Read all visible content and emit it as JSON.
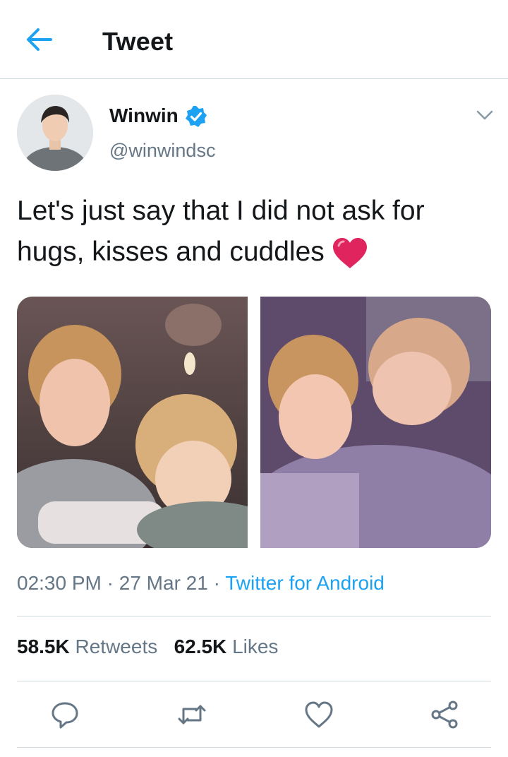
{
  "header": {
    "title": "Tweet",
    "back_icon": "arrow-left-icon"
  },
  "author": {
    "name": "Winwin",
    "handle": "@winwindsc",
    "verified": true,
    "verified_icon": "verified-badge-icon"
  },
  "tweet": {
    "text": "Let's just say that I did not ask for hugs, kisses and cuddles",
    "emoji": "red-heart-emoji"
  },
  "media": [
    {
      "name": "photo-1"
    },
    {
      "name": "photo-2"
    }
  ],
  "meta": {
    "time": "02:30 PM",
    "sep1": " · ",
    "date": "27 Mar 21",
    "sep2": " · ",
    "source": "Twitter for Android"
  },
  "stats": {
    "retweets_count": "58.5K",
    "retweets_label": "Retweets",
    "likes_count": "62.5K",
    "likes_label": "Likes"
  },
  "actions": [
    "reply-icon",
    "retweet-icon",
    "like-icon",
    "share-icon"
  ],
  "colors": {
    "accent": "#1da1f2",
    "secondary_text": "#657786",
    "divider": "#cfd9de",
    "heart": "#e0245e"
  }
}
